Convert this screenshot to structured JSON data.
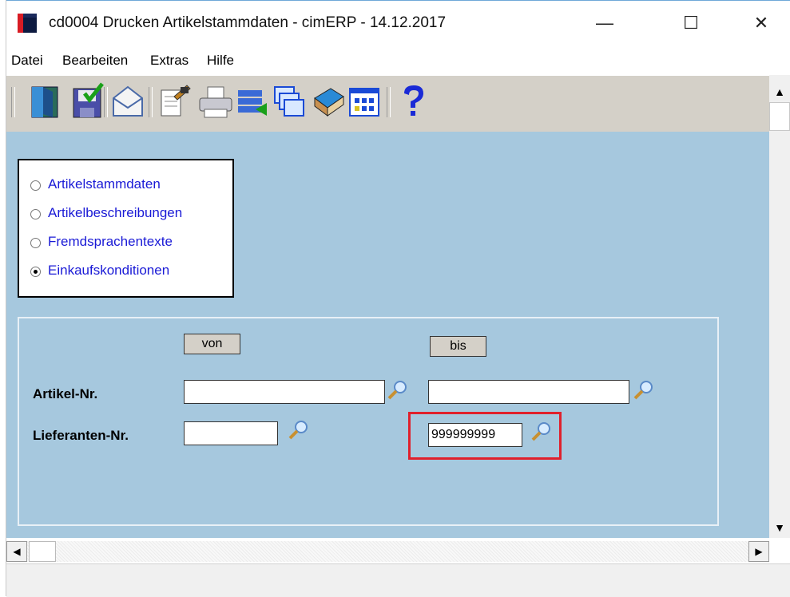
{
  "window": {
    "title": "cd0004 Drucken Artikelstammdaten - cimERP - 14.12.2017",
    "minimize": "—",
    "maximize": "☐",
    "close": "✕"
  },
  "menu": [
    "Datei",
    "Bearbeiten",
    "Extras",
    "Hilfe"
  ],
  "toolbar": {
    "icons": [
      "exit-door-icon",
      "save-icon",
      "email-icon",
      "edit-document-icon",
      "printer-icon",
      "export-list-icon",
      "windows-icon",
      "book-icon",
      "calendar-grid-icon",
      "help-icon"
    ]
  },
  "report_type": {
    "options": [
      "Artikelstammdaten",
      "Artikelbeschreibungen",
      "Fremdsprachentexte",
      "Einkaufskonditionen"
    ],
    "selected": "Einkaufskonditionen"
  },
  "filters": {
    "von_label": "von",
    "bis_label": "bis",
    "artikel_label": "Artikel-Nr.",
    "lieferant_label": "Lieferanten-Nr.",
    "artikel_von": "",
    "artikel_bis": "",
    "lieferant_von": "",
    "lieferant_bis": "999999999"
  },
  "colors": {
    "content_bg": "#a6c8de",
    "radio_text": "#1a1ad6",
    "highlight": "#e0202c"
  }
}
